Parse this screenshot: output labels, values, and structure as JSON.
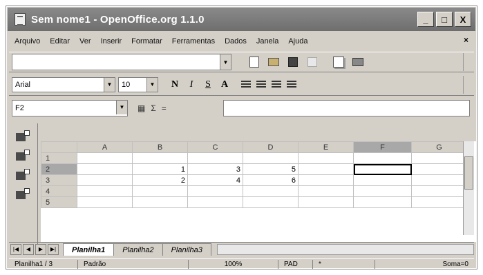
{
  "window": {
    "title": "Sem nome1 - OpenOffice.org 1.1.0"
  },
  "window_buttons": {
    "minimize": "_",
    "maximize": "□",
    "close": "X"
  },
  "menu": [
    "Arquivo",
    "Editar",
    "Ver",
    "Inserir",
    "Formatar",
    "Ferramentas",
    "Dados",
    "Janela",
    "Ajuda"
  ],
  "menu_close": "×",
  "object_bar": {
    "font_name": "Arial",
    "font_size": "10",
    "bold": "N",
    "italic": "I",
    "underline": "S",
    "font_color": "A"
  },
  "formula_bar": {
    "name_box": "F2"
  },
  "grid": {
    "columns": [
      "A",
      "B",
      "C",
      "D",
      "E",
      "F",
      "G"
    ],
    "rows": [
      {
        "header": "1",
        "cells": [
          "",
          "",
          "",
          "",
          "",
          "",
          ""
        ]
      },
      {
        "header": "2",
        "cells": [
          "",
          "1",
          "3",
          "5",
          "",
          "",
          ""
        ]
      },
      {
        "header": "3",
        "cells": [
          "",
          "2",
          "4",
          "6",
          "",
          "",
          ""
        ]
      },
      {
        "header": "4",
        "cells": [
          "",
          "",
          "",
          "",
          "",
          "",
          ""
        ]
      },
      {
        "header": "5",
        "cells": [
          "",
          "",
          "",
          "",
          "",
          "",
          ""
        ]
      }
    ]
  },
  "sheet_tabs": [
    "Planilha1",
    "Planilha2",
    "Planilha3"
  ],
  "status": {
    "sheet": "Planilha1 / 3",
    "style": "Padrão",
    "zoom": "100%",
    "mode": "PAD",
    "modified": "*",
    "selection": "Soma=0"
  }
}
